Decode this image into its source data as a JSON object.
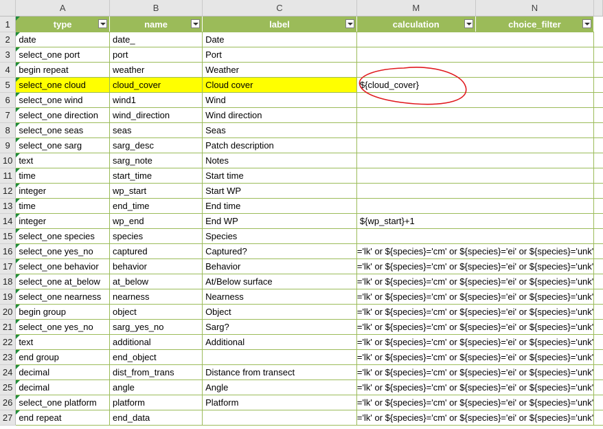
{
  "column_letters": [
    "A",
    "B",
    "C",
    "M",
    "N"
  ],
  "header": {
    "type": "type",
    "name": "name",
    "label": "label",
    "calculation": "calculation",
    "choice_filter": "choice_filter"
  },
  "rows": [
    {
      "num": "2",
      "type": "date",
      "name": "date_",
      "label": "Date",
      "calc": ""
    },
    {
      "num": "3",
      "type": "select_one port",
      "name": "port",
      "label": "Port",
      "calc": ""
    },
    {
      "num": "4",
      "type": "begin repeat",
      "name": "weather",
      "label": "Weather",
      "calc": ""
    },
    {
      "num": "5",
      "type": "select_one cloud",
      "name": "cloud_cover",
      "label": "Cloud cover",
      "calc": "${cloud_cover}"
    },
    {
      "num": "6",
      "type": "select_one wind",
      "name": "wind1",
      "label": "Wind",
      "calc": ""
    },
    {
      "num": "7",
      "type": "select_one direction",
      "name": "wind_direction",
      "label": "Wind direction",
      "calc": ""
    },
    {
      "num": "8",
      "type": "select_one seas",
      "name": "seas",
      "label": "Seas",
      "calc": ""
    },
    {
      "num": "9",
      "type": "select_one sarg",
      "name": "sarg_desc",
      "label": "Patch description",
      "calc": ""
    },
    {
      "num": "10",
      "type": "text",
      "name": "sarg_note",
      "label": "Notes",
      "calc": ""
    },
    {
      "num": "11",
      "type": "time",
      "name": "start_time",
      "label": "Start time",
      "calc": ""
    },
    {
      "num": "12",
      "type": "integer",
      "name": "wp_start",
      "label": "Start WP",
      "calc": ""
    },
    {
      "num": "13",
      "type": "time",
      "name": "end_time",
      "label": "End time",
      "calc": ""
    },
    {
      "num": "14",
      "type": "integer",
      "name": "wp_end",
      "label": "End WP",
      "calc": "${wp_start}+1"
    },
    {
      "num": "15",
      "type": "select_one species",
      "name": "species",
      "label": "Species",
      "calc": ""
    },
    {
      "num": "16",
      "type": "select_one yes_no",
      "name": "captured",
      "label": "Captured?",
      "calc": "='lk' or ${species}='cm' or ${species}='ei' or ${species}='unk'"
    },
    {
      "num": "17",
      "type": "select_one behavior",
      "name": "behavior",
      "label": "Behavior",
      "calc": "='lk' or ${species}='cm' or ${species}='ei' or ${species}='unk'"
    },
    {
      "num": "18",
      "type": "select_one at_below",
      "name": "at_below",
      "label": "At/Below surface",
      "calc": "='lk' or ${species}='cm' or ${species}='ei' or ${species}='unk'"
    },
    {
      "num": "19",
      "type": "select_one nearness",
      "name": "nearness",
      "label": "Nearness",
      "calc": "='lk' or ${species}='cm' or ${species}='ei' or ${species}='unk'"
    },
    {
      "num": "20",
      "type": "begin group",
      "name": "object",
      "label": "Object",
      "calc": "='lk' or ${species}='cm' or ${species}='ei' or ${species}='unk'"
    },
    {
      "num": "21",
      "type": "select_one yes_no",
      "name": "sarg_yes_no",
      "label": "Sarg?",
      "calc": "='lk' or ${species}='cm' or ${species}='ei' or ${species}='unk'"
    },
    {
      "num": "22",
      "type": "text",
      "name": "additional",
      "label": "Additional",
      "calc": "='lk' or ${species}='cm' or ${species}='ei' or ${species}='unk'"
    },
    {
      "num": "23",
      "type": "end group",
      "name": "end_object",
      "label": "",
      "calc": "='lk' or ${species}='cm' or ${species}='ei' or ${species}='unk'"
    },
    {
      "num": "24",
      "type": "decimal",
      "name": "dist_from_trans",
      "label": "Distance from transect",
      "calc": "='lk' or ${species}='cm' or ${species}='ei' or ${species}='unk'"
    },
    {
      "num": "25",
      "type": "decimal",
      "name": "angle",
      "label": "Angle",
      "calc": "='lk' or ${species}='cm' or ${species}='ei' or ${species}='unk'"
    },
    {
      "num": "26",
      "type": "select_one platform",
      "name": "platform",
      "label": "Platform",
      "calc": "='lk' or ${species}='cm' or ${species}='ei' or ${species}='unk'"
    },
    {
      "num": "27",
      "type": "end repeat",
      "name": "end_data",
      "label": "",
      "calc": "='lk' or ${species}='cm' or ${species}='ei' or ${species}='unk'"
    }
  ],
  "header_row_num": "1",
  "highlighted_row": "5",
  "colors": {
    "header_green": "#9bbb59",
    "highlight_yellow": "#ffff00",
    "annotation_red": "#e0191e"
  }
}
